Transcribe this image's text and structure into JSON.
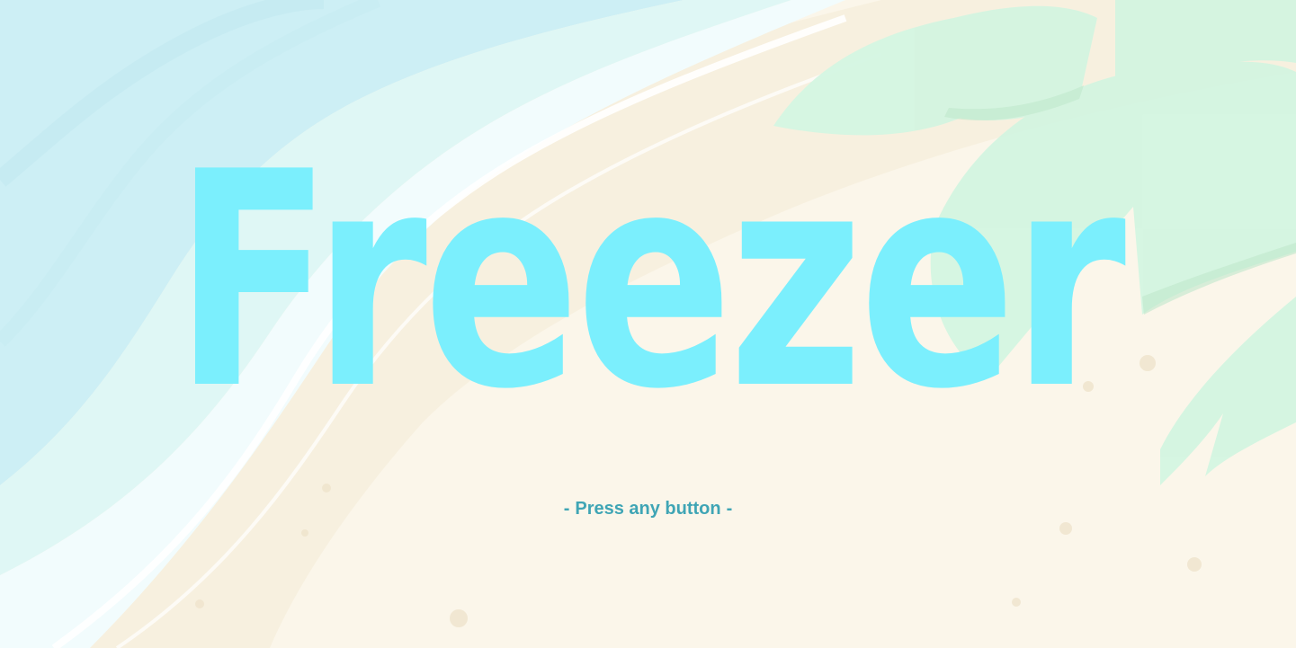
{
  "title_screen": {
    "title": "Freezer",
    "prompt": {
      "dash_left": "-",
      "text": "Press any button",
      "dash_right": "-"
    }
  },
  "colors": {
    "title": "#7beffd",
    "prompt": "#3fa5b5",
    "sand": "#fbf6ea",
    "water": "#d2f2f6",
    "foam": "#f2fcfd",
    "leaves": "#d7f6e4"
  },
  "icons": {
    "background": "beach-shoreline-illustration",
    "foliage": "palm-leaves-illustration"
  }
}
